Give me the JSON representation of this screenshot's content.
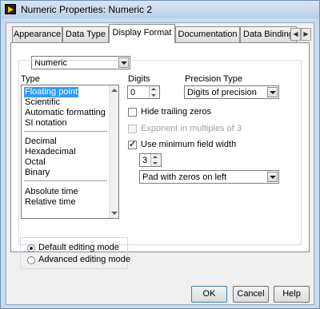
{
  "window": {
    "title": "Numeric Properties: Numeric 2"
  },
  "tabs": [
    "Appearance",
    "Data Type",
    "Display Format",
    "Documentation",
    "Data Binding"
  ],
  "active_tab": "Display Format",
  "format_type_select": "Numeric",
  "type_label": "Type",
  "type_list": {
    "group1": [
      "Floating point",
      "Scientific",
      "Automatic formatting",
      "SI notation"
    ],
    "group2": [
      "Decimal",
      "Hexadecimal",
      "Octal",
      "Binary"
    ],
    "group3": [
      "Absolute time",
      "Relative time"
    ],
    "selected": "Floating point"
  },
  "digits": {
    "label": "Digits",
    "value": "0"
  },
  "precision_type": {
    "label": "Precision Type",
    "value": "Digits of precision"
  },
  "options": {
    "hide_trailing_zeros": {
      "label": "Hide trailing zeros",
      "checked": false,
      "enabled": true
    },
    "exponent_multiples": {
      "label": "Exponent in multiples of 3",
      "checked": false,
      "enabled": false
    },
    "use_min_field_width": {
      "label": "Use minimum field width",
      "checked": true,
      "enabled": true
    }
  },
  "min_field_width": {
    "value": "3",
    "padding": "Pad with zeros on left"
  },
  "editing_mode": {
    "default_label": "Default editing mode",
    "advanced_label": "Advanced editing mode",
    "selected": "default"
  },
  "buttons": {
    "ok": "OK",
    "cancel": "Cancel",
    "help": "Help"
  },
  "colors": {
    "selection": "#3399ff",
    "title_bar": "#c8dbef"
  }
}
